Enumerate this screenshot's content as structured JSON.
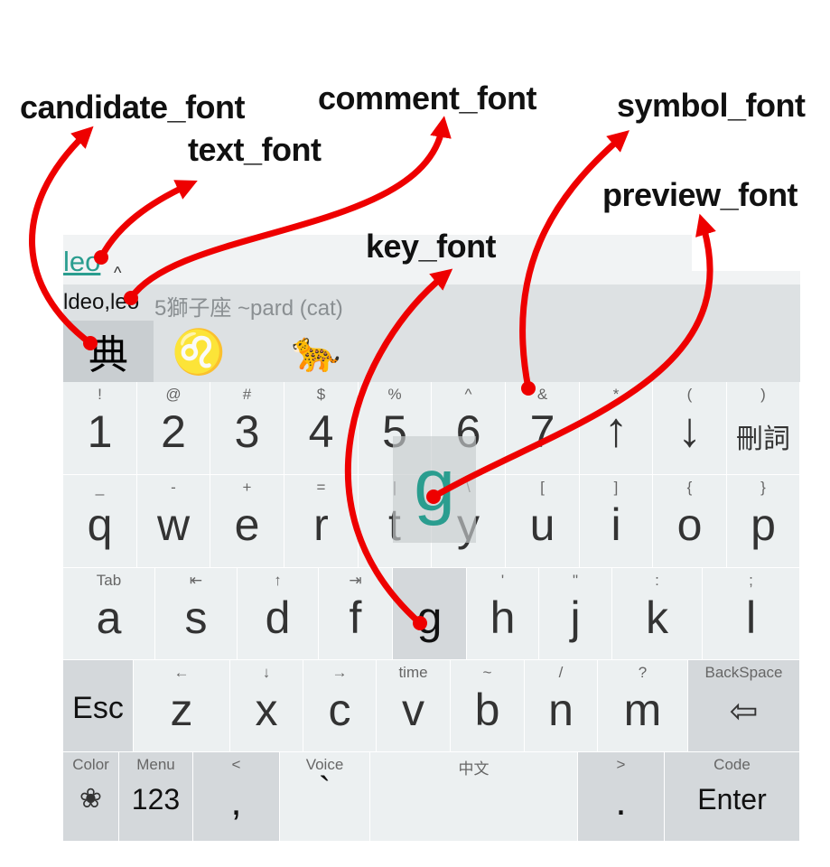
{
  "annotations": {
    "candidate_font": "candidate_font",
    "text_font": "text_font",
    "comment_font": "comment_font",
    "symbol_font": "symbol_font",
    "preview_font": "preview_font",
    "key_font": "key_font"
  },
  "composition": {
    "text": "leo",
    "caret": "^"
  },
  "comment_bar": {
    "text": "ldeo,leo",
    "comment": "5獅子座 ~pard (cat)"
  },
  "candidates": [
    "典",
    "♌",
    "🐆"
  ],
  "preview": "g",
  "keys": {
    "row1": [
      {
        "sym": "!",
        "label": "1"
      },
      {
        "sym": "@",
        "label": "2"
      },
      {
        "sym": "#",
        "label": "3"
      },
      {
        "sym": "$",
        "label": "4"
      },
      {
        "sym": "%",
        "label": "5"
      },
      {
        "sym": "^",
        "label": "6"
      },
      {
        "sym": "&",
        "label": "7"
      },
      {
        "sym": "*",
        "label": "↑"
      },
      {
        "sym": "(",
        "label": "↓"
      },
      {
        "sym": ")",
        "label": "刪詞"
      }
    ],
    "row2": [
      {
        "sym": "_",
        "label": "q"
      },
      {
        "sym": "-",
        "label": "w"
      },
      {
        "sym": "+",
        "label": "e"
      },
      {
        "sym": "=",
        "label": "r"
      },
      {
        "sym": "|",
        "label": "t"
      },
      {
        "sym": "\\",
        "label": "y"
      },
      {
        "sym": "[",
        "label": "u"
      },
      {
        "sym": "]",
        "label": "i"
      },
      {
        "sym": "{",
        "label": "o"
      },
      {
        "sym": "}",
        "label": "p"
      }
    ],
    "row3": [
      {
        "sym": "Tab",
        "label": "a"
      },
      {
        "sym": "⇤",
        "label": "s"
      },
      {
        "sym": "↑",
        "label": "d"
      },
      {
        "sym": "⇥",
        "label": "f"
      },
      {
        "sym": "",
        "label": "g"
      },
      {
        "sym": "'",
        "label": "h"
      },
      {
        "sym": "\"",
        "label": "j"
      },
      {
        "sym": ":",
        "label": "k"
      },
      {
        "sym": ";",
        "label": "l"
      }
    ],
    "row4": [
      {
        "sym": "",
        "label": "Esc"
      },
      {
        "sym": "←",
        "label": "z"
      },
      {
        "sym": "↓",
        "label": "x"
      },
      {
        "sym": "→",
        "label": "c"
      },
      {
        "sym": "time",
        "label": "v"
      },
      {
        "sym": "~",
        "label": "b"
      },
      {
        "sym": "/",
        "label": "n"
      },
      {
        "sym": "?",
        "label": "m"
      },
      {
        "sym": "BackSpace",
        "label": "⇦"
      }
    ],
    "row5": [
      {
        "sym": "Color",
        "label": "❀"
      },
      {
        "sym": "Menu",
        "label": "123"
      },
      {
        "sym": "<",
        "label": ","
      },
      {
        "sym": "Voice",
        "label": "`"
      },
      {
        "sym": "中文",
        "label": ""
      },
      {
        "sym": ">",
        "label": "."
      },
      {
        "sym": "Code",
        "label": "Enter"
      }
    ]
  },
  "colors": {
    "accent": "#2a9d8f",
    "arrow": "#ee0000",
    "key_bg": "#ecf0f1",
    "key_dark": "#d4d8db"
  }
}
